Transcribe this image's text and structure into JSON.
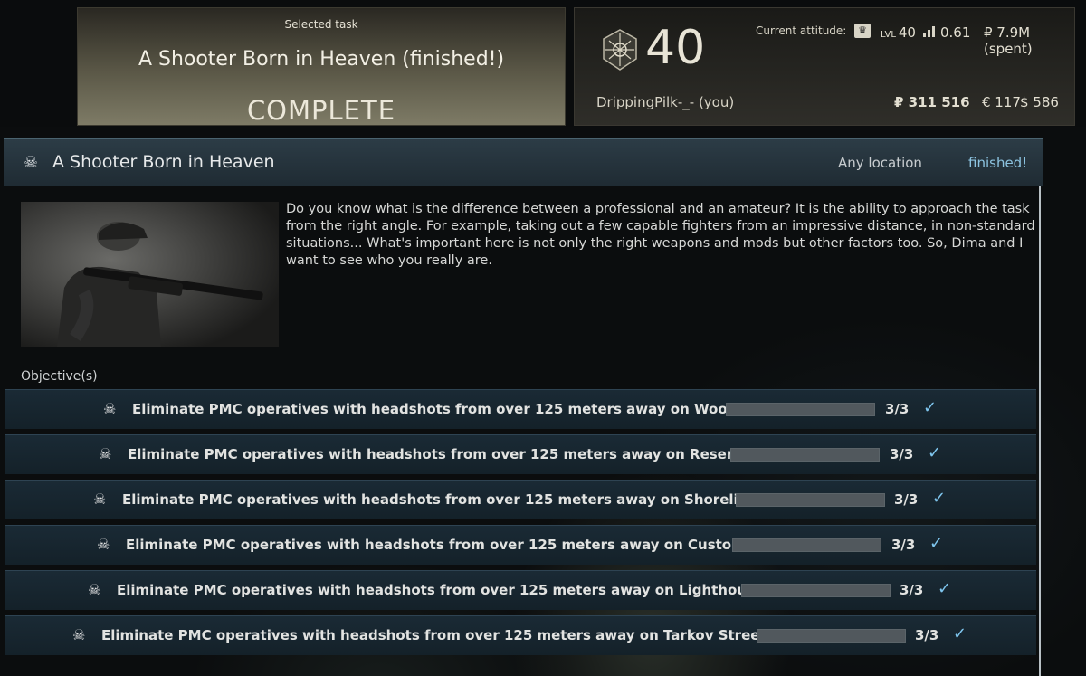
{
  "selected_task": {
    "label": "Selected task",
    "title": "A Shooter Born in Heaven (finished!)",
    "status": "COMPLETE"
  },
  "profile": {
    "level": "40",
    "player_name": "DrippingPilk-_- (you)",
    "attitude_label": "Current attitude:",
    "lvl_tag": "LVL",
    "trader_level": "40",
    "standing": "0.61",
    "spent": "₽ 7.9M (spent)",
    "roubles": "₽ 311 516",
    "euros": "€ 117",
    "dollars": "$ 586"
  },
  "task": {
    "name": "A Shooter Born in Heaven",
    "location": "Any location",
    "state": "finished!",
    "description": "Do you know what is the difference between a professional and an amateur? It is the ability to approach the task from the right angle. For example, taking out a few capable fighters from an impressive distance, in non-standard situations... What's important here is not only the right weapons and mods but other factors too. So, Dima and I want to see who you really are.",
    "objectives_label": "Objective(s)"
  },
  "objectives": [
    {
      "text": "Eliminate PMC operatives with headshots from over 125 meters away on Woods",
      "count": "3/3",
      "progress": 1.0
    },
    {
      "text": "Eliminate PMC operatives with headshots from over 125 meters away on Reserve",
      "count": "3/3",
      "progress": 1.0
    },
    {
      "text": "Eliminate PMC operatives with headshots from over 125 meters away on Shoreline",
      "count": "3/3",
      "progress": 1.0
    },
    {
      "text": "Eliminate PMC operatives with headshots from over 125 meters away on Customs",
      "count": "3/3",
      "progress": 1.0
    },
    {
      "text": "Eliminate PMC operatives with headshots from over 125 meters away on Lighthouse",
      "count": "3/3",
      "progress": 1.0
    },
    {
      "text": "Eliminate PMC operatives with headshots from over 125 meters away on Tarkov Streets",
      "count": "3/3",
      "progress": 1.0
    }
  ],
  "icons": {
    "task_type": "skull-icon",
    "objective": "skull-icon",
    "complete": "checkmark-icon",
    "attitude": "crown-icon",
    "standing": "signal-bars-icon",
    "rank": "rank-badge-icon"
  },
  "colors": {
    "accent_blue": "#8cc3e0",
    "check_blue": "#7fc6ef",
    "header_bg": "#2c3c46"
  }
}
